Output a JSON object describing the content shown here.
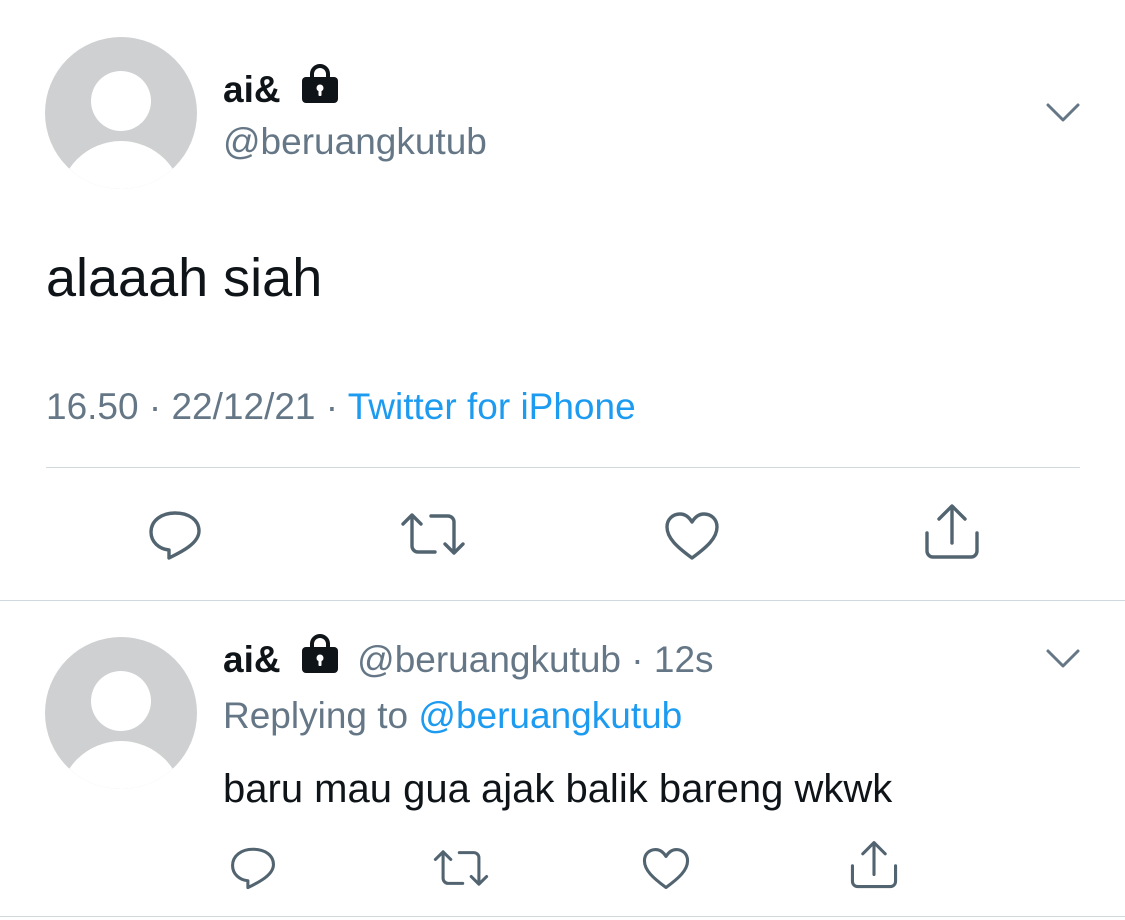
{
  "main_tweet": {
    "display_name": "ai&",
    "handle": "@beruangkutub",
    "text": "alaaah siah",
    "time": "16.50",
    "separator": "·",
    "date": "22/12/21",
    "source": "Twitter for iPhone"
  },
  "reply_tweet": {
    "display_name": "ai&",
    "handle": "@beruangkutub",
    "separator": "·",
    "age": "12s",
    "replying_label": "Replying to",
    "replying_handle": "@beruangkutub",
    "text": "baru mau gua ajak balik bareng wkwk"
  },
  "icons": {
    "lock": "lock-icon",
    "chevron": "chevron-down-icon",
    "reply": "reply-icon",
    "retweet": "retweet-icon",
    "like": "heart-icon",
    "share": "share-icon"
  },
  "colors": {
    "text": "#0f1419",
    "muted": "#657786",
    "link": "#1d9bf0",
    "divider": "#cfd9de",
    "avatar": "#cfd0d1"
  }
}
